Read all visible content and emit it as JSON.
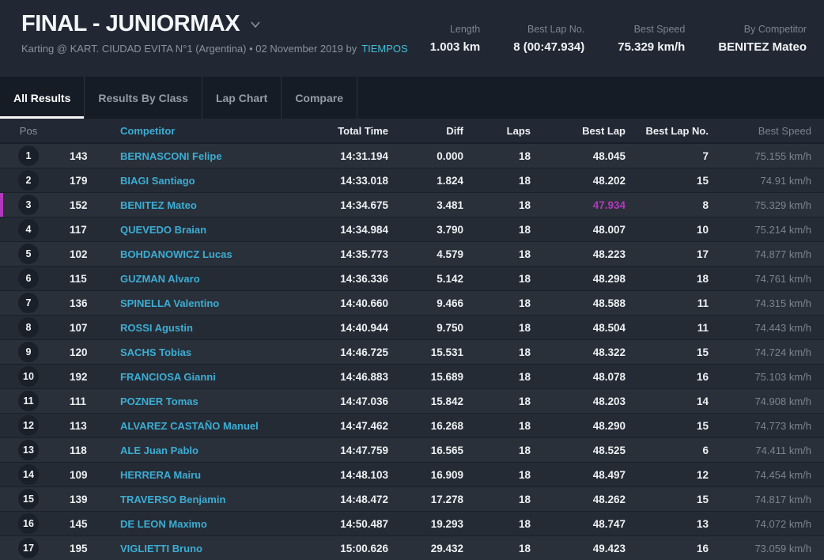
{
  "header": {
    "title": "FINAL - JUNIORMAX",
    "subtitle": "Karting @ KART. CIUDAD EVITA N°1 (Argentina) • 02 November 2019 by",
    "link": "TIEMPOS",
    "stats": [
      {
        "label": "Length",
        "value": "1.003 km"
      },
      {
        "label": "Best Lap No.",
        "value": "8 (00:47.934)"
      },
      {
        "label": "Best Speed",
        "value": "75.329 km/h"
      },
      {
        "label": "By Competitor",
        "value": "BENITEZ Mateo"
      }
    ]
  },
  "tabs": [
    {
      "label": "All Results",
      "active": true
    },
    {
      "label": "Results By Class",
      "active": false
    },
    {
      "label": "Lap Chart",
      "active": false
    },
    {
      "label": "Compare",
      "active": false
    }
  ],
  "table": {
    "columns": [
      "Pos",
      "Competitor",
      "Total Time",
      "Diff",
      "Laps",
      "Best Lap",
      "Best Lap No.",
      "Best Speed"
    ],
    "rows": [
      {
        "pos": "1",
        "no": "143",
        "name": "BERNASCONI Felipe",
        "total_time": "14:31.194",
        "diff": "0.000",
        "laps": "18",
        "best_lap": "48.045",
        "best_lap_no": "7",
        "best_speed": "75.155 km/h",
        "highlight": false,
        "best_lap_hot": false
      },
      {
        "pos": "2",
        "no": "179",
        "name": "BIAGI Santiago",
        "total_time": "14:33.018",
        "diff": "1.824",
        "laps": "18",
        "best_lap": "48.202",
        "best_lap_no": "15",
        "best_speed": "74.91 km/h",
        "highlight": false,
        "best_lap_hot": false
      },
      {
        "pos": "3",
        "no": "152",
        "name": "BENITEZ Mateo",
        "total_time": "14:34.675",
        "diff": "3.481",
        "laps": "18",
        "best_lap": "47.934",
        "best_lap_no": "8",
        "best_speed": "75.329 km/h",
        "highlight": true,
        "best_lap_hot": true
      },
      {
        "pos": "4",
        "no": "117",
        "name": "QUEVEDO Braian",
        "total_time": "14:34.984",
        "diff": "3.790",
        "laps": "18",
        "best_lap": "48.007",
        "best_lap_no": "10",
        "best_speed": "75.214 km/h",
        "highlight": false,
        "best_lap_hot": false
      },
      {
        "pos": "5",
        "no": "102",
        "name": "BOHDANOWICZ Lucas",
        "total_time": "14:35.773",
        "diff": "4.579",
        "laps": "18",
        "best_lap": "48.223",
        "best_lap_no": "17",
        "best_speed": "74.877 km/h",
        "highlight": false,
        "best_lap_hot": false
      },
      {
        "pos": "6",
        "no": "115",
        "name": "GUZMAN Alvaro",
        "total_time": "14:36.336",
        "diff": "5.142",
        "laps": "18",
        "best_lap": "48.298",
        "best_lap_no": "18",
        "best_speed": "74.761 km/h",
        "highlight": false,
        "best_lap_hot": false
      },
      {
        "pos": "7",
        "no": "136",
        "name": "SPINELLA Valentino",
        "total_time": "14:40.660",
        "diff": "9.466",
        "laps": "18",
        "best_lap": "48.588",
        "best_lap_no": "11",
        "best_speed": "74.315 km/h",
        "highlight": false,
        "best_lap_hot": false
      },
      {
        "pos": "8",
        "no": "107",
        "name": "ROSSI Agustin",
        "total_time": "14:40.944",
        "diff": "9.750",
        "laps": "18",
        "best_lap": "48.504",
        "best_lap_no": "11",
        "best_speed": "74.443 km/h",
        "highlight": false,
        "best_lap_hot": false
      },
      {
        "pos": "9",
        "no": "120",
        "name": "SACHS Tobias",
        "total_time": "14:46.725",
        "diff": "15.531",
        "laps": "18",
        "best_lap": "48.322",
        "best_lap_no": "15",
        "best_speed": "74.724 km/h",
        "highlight": false,
        "best_lap_hot": false
      },
      {
        "pos": "10",
        "no": "192",
        "name": "FRANCIOSA Gianni",
        "total_time": "14:46.883",
        "diff": "15.689",
        "laps": "18",
        "best_lap": "48.078",
        "best_lap_no": "16",
        "best_speed": "75.103 km/h",
        "highlight": false,
        "best_lap_hot": false
      },
      {
        "pos": "11",
        "no": "111",
        "name": "POZNER Tomas",
        "total_time": "14:47.036",
        "diff": "15.842",
        "laps": "18",
        "best_lap": "48.203",
        "best_lap_no": "14",
        "best_speed": "74.908 km/h",
        "highlight": false,
        "best_lap_hot": false
      },
      {
        "pos": "12",
        "no": "113",
        "name": "ALVAREZ CASTAÑO Manuel",
        "total_time": "14:47.462",
        "diff": "16.268",
        "laps": "18",
        "best_lap": "48.290",
        "best_lap_no": "15",
        "best_speed": "74.773 km/h",
        "highlight": false,
        "best_lap_hot": false
      },
      {
        "pos": "13",
        "no": "118",
        "name": "ALE Juan Pablo",
        "total_time": "14:47.759",
        "diff": "16.565",
        "laps": "18",
        "best_lap": "48.525",
        "best_lap_no": "6",
        "best_speed": "74.411 km/h",
        "highlight": false,
        "best_lap_hot": false
      },
      {
        "pos": "14",
        "no": "109",
        "name": "HERRERA Mairu",
        "total_time": "14:48.103",
        "diff": "16.909",
        "laps": "18",
        "best_lap": "48.497",
        "best_lap_no": "12",
        "best_speed": "74.454 km/h",
        "highlight": false,
        "best_lap_hot": false
      },
      {
        "pos": "15",
        "no": "139",
        "name": "TRAVERSO Benjamin",
        "total_time": "14:48.472",
        "diff": "17.278",
        "laps": "18",
        "best_lap": "48.262",
        "best_lap_no": "15",
        "best_speed": "74.817 km/h",
        "highlight": false,
        "best_lap_hot": false
      },
      {
        "pos": "16",
        "no": "145",
        "name": "DE LEON Maximo",
        "total_time": "14:50.487",
        "diff": "19.293",
        "laps": "18",
        "best_lap": "48.747",
        "best_lap_no": "13",
        "best_speed": "74.072 km/h",
        "highlight": false,
        "best_lap_hot": false
      },
      {
        "pos": "17",
        "no": "195",
        "name": "VIGLIETTI Bruno",
        "total_time": "15:00.626",
        "diff": "29.432",
        "laps": "18",
        "best_lap": "49.423",
        "best_lap_no": "16",
        "best_speed": "73.059 km/h",
        "highlight": false,
        "best_lap_hot": false
      }
    ]
  },
  "colors": {
    "accent_cyan": "#3cadd4",
    "highlight_magenta": "#b238bb",
    "row_bg": "#252b35",
    "header_bg": "#212834",
    "tabs_bg": "#161c25"
  }
}
